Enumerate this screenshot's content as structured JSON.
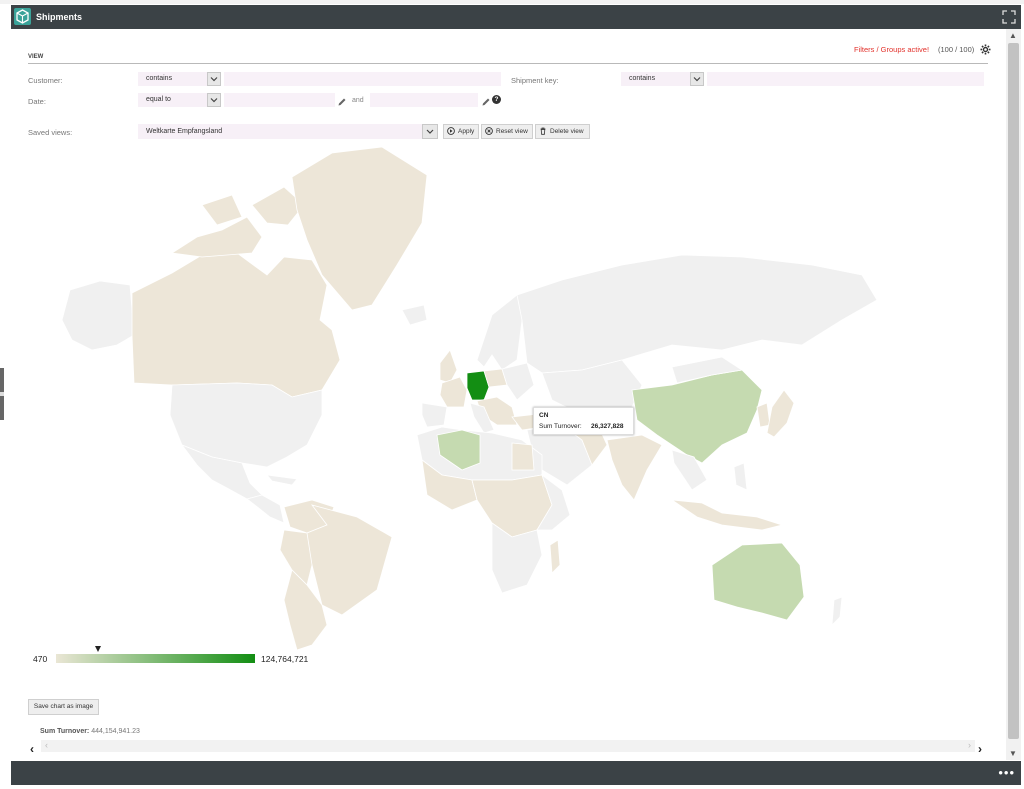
{
  "window": {
    "title": "Shipments"
  },
  "status": {
    "filters_active": "Filters / Groups active!",
    "count": "(100 / 100)"
  },
  "section": {
    "label": "VIEW"
  },
  "filters": {
    "customer": {
      "label": "Customer:",
      "operator": "contains",
      "value": ""
    },
    "shipment_key": {
      "label": "Shipment key:",
      "operator": "contains",
      "value": ""
    },
    "date": {
      "label": "Date:",
      "operator": "equal to",
      "from": "",
      "and_label": "and",
      "to": ""
    },
    "saved_views": {
      "label": "Saved views:",
      "value": "Weltkarte Empfangsland"
    }
  },
  "buttons": {
    "apply": "Apply",
    "reset": "Reset view",
    "delete": "Delete view",
    "save_chart": "Save chart as image"
  },
  "map": {
    "tooltip": {
      "key": "CN",
      "label": "Sum Turnover:",
      "value": "26,327,828"
    },
    "legend": {
      "min_label": "470",
      "max_label": "124,764,721",
      "min": 470,
      "max": 124764721,
      "marker_value": 26327828
    },
    "colors": {
      "no_data": "#f0f0f0",
      "low": "#ede6d8",
      "mid": "#c5dab0",
      "high": "#138e13"
    }
  },
  "summary": {
    "label": "Sum Turnover:",
    "value": "444,154,941.23"
  },
  "icons": [
    "app-cube-icon",
    "fullscreen-icon",
    "gear-icon",
    "chevron-down-icon",
    "pencil-icon",
    "help-icon",
    "play-icon",
    "reset-icon",
    "trash-icon",
    "more-icon"
  ]
}
